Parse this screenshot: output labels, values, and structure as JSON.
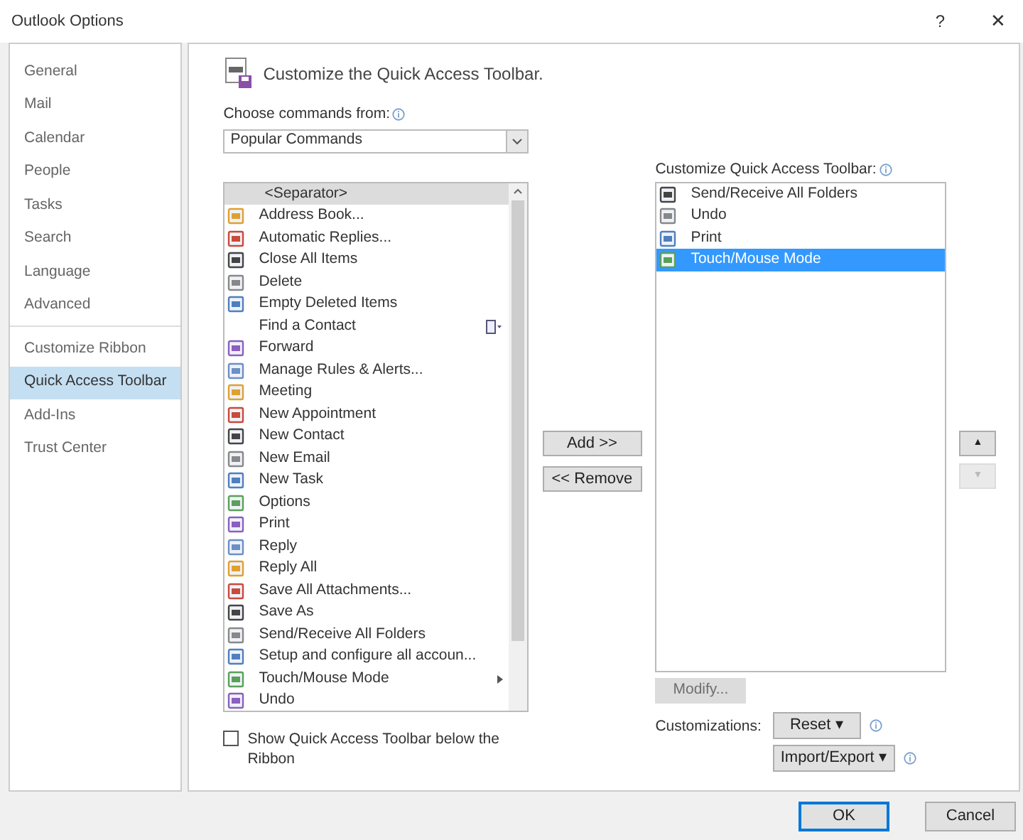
{
  "window": {
    "title": "Outlook Options",
    "help": "?",
    "close": "✕"
  },
  "sidebar": {
    "sections": [
      {
        "items": [
          {
            "label": "General",
            "selected": false
          },
          {
            "label": "Mail",
            "selected": false
          },
          {
            "label": "Calendar",
            "selected": false
          },
          {
            "label": "People",
            "selected": false
          },
          {
            "label": "Tasks",
            "selected": false
          },
          {
            "label": "Search",
            "selected": false
          },
          {
            "label": "Language",
            "selected": false
          },
          {
            "label": "Advanced",
            "selected": false
          }
        ]
      },
      {
        "items": [
          {
            "label": "Customize Ribbon",
            "selected": false
          },
          {
            "label": "Quick Access Toolbar",
            "selected": true
          },
          {
            "label": "Add-Ins",
            "selected": false
          },
          {
            "label": "Trust Center",
            "selected": false
          }
        ]
      }
    ]
  },
  "heading": "Customize the Quick Access Toolbar.",
  "choose": {
    "label": "Choose commands from:",
    "value": "Popular Commands"
  },
  "commands": [
    {
      "label": "<Separator>",
      "kind": "separator",
      "selected": true
    },
    {
      "label": "Address Book...",
      "kind": "command",
      "selected": false
    },
    {
      "label": "Automatic Replies...",
      "kind": "command",
      "selected": false
    },
    {
      "label": "Close All Items",
      "kind": "command",
      "selected": false
    },
    {
      "label": "Delete",
      "kind": "command",
      "selected": false
    },
    {
      "label": "Empty Deleted Items",
      "kind": "command",
      "selected": false
    },
    {
      "label": "Find a Contact",
      "kind": "field",
      "selected": false
    },
    {
      "label": "Forward",
      "kind": "command",
      "selected": false
    },
    {
      "label": "Manage Rules & Alerts...",
      "kind": "command",
      "selected": false
    },
    {
      "label": "Meeting",
      "kind": "command",
      "selected": false
    },
    {
      "label": "New Appointment",
      "kind": "command",
      "selected": false
    },
    {
      "label": "New Contact",
      "kind": "command",
      "selected": false
    },
    {
      "label": "New Email",
      "kind": "command",
      "selected": false
    },
    {
      "label": "New Task",
      "kind": "command",
      "selected": false
    },
    {
      "label": "Options",
      "kind": "command",
      "selected": false
    },
    {
      "label": "Print",
      "kind": "command",
      "selected": false
    },
    {
      "label": "Reply",
      "kind": "command",
      "selected": false
    },
    {
      "label": "Reply All",
      "kind": "command",
      "selected": false
    },
    {
      "label": "Save All Attachments...",
      "kind": "command",
      "selected": false
    },
    {
      "label": "Save As",
      "kind": "command",
      "selected": false
    },
    {
      "label": "Send/Receive All Folders",
      "kind": "command",
      "selected": false
    },
    {
      "label": "Setup and configure all accoun...",
      "kind": "command",
      "selected": false
    },
    {
      "label": "Touch/Mouse Mode",
      "kind": "submenu",
      "selected": false
    },
    {
      "label": "Undo",
      "kind": "command",
      "selected": false
    }
  ],
  "show_below": {
    "label": "Show Quick Access Toolbar below the Ribbon",
    "checked": false
  },
  "add_button": "Add >>",
  "remove_button": "<< Remove",
  "toolbar": {
    "label": "Customize Quick Access Toolbar:",
    "items": [
      {
        "label": "Send/Receive All Folders",
        "selected": false
      },
      {
        "label": "Undo",
        "selected": false
      },
      {
        "label": "Print",
        "selected": false
      },
      {
        "label": "Touch/Mouse Mode",
        "selected": true
      }
    ]
  },
  "move_up": {
    "label": "▲",
    "disabled": false
  },
  "move_down": {
    "label": "▼",
    "disabled": true
  },
  "modify": {
    "label": "Modify...",
    "disabled": true
  },
  "customizations": {
    "label": "Customizations:",
    "reset": "Reset ▾",
    "import_export": "Import/Export ▾"
  },
  "buttons": [
    {
      "label": "OK",
      "selected": true
    },
    {
      "label": "Cancel",
      "selected": false
    }
  ]
}
